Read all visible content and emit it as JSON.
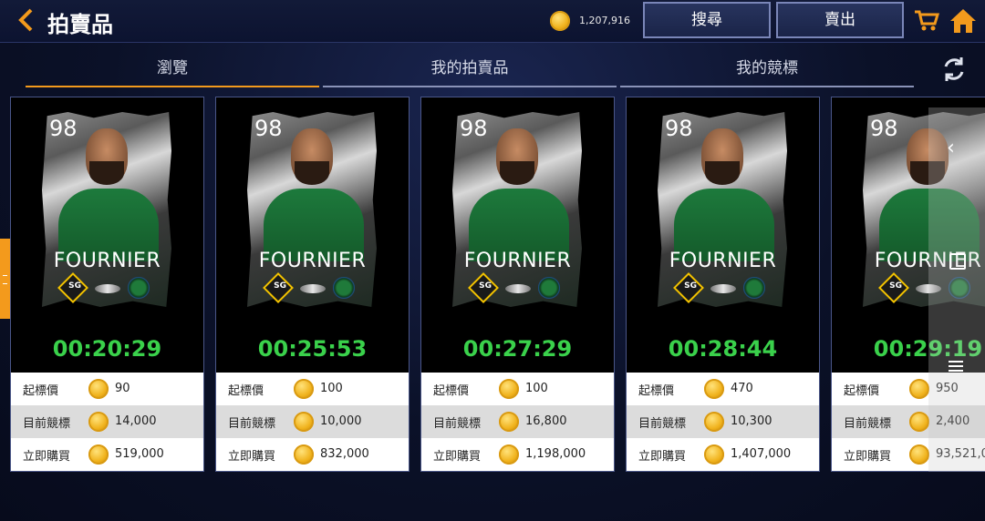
{
  "header": {
    "back_icon": "chevron-left-icon",
    "title": "拍賣品",
    "balance": "1,207,916",
    "search_label": "搜尋",
    "sell_label": "賣出",
    "cart_icon": "cart-icon",
    "home_icon": "home-icon",
    "accent_color": "#f39a1c"
  },
  "tabs": [
    {
      "label": "瀏覽",
      "active": true
    },
    {
      "label": "我的拍賣品",
      "active": false
    },
    {
      "label": "我的競標",
      "active": false
    }
  ],
  "refresh_icon": "refresh-icon",
  "row_labels": {
    "start": "起標價",
    "current": "目前競標",
    "buy": "立即購買"
  },
  "cards": [
    {
      "rating": "98",
      "name": "FOURNIER",
      "position": "SG",
      "timer": "00:20:29",
      "start": "90",
      "current": "14,000",
      "buy": "519,000"
    },
    {
      "rating": "98",
      "name": "FOURNIER",
      "position": "SG",
      "timer": "00:25:53",
      "start": "100",
      "current": "10,000",
      "buy": "832,000"
    },
    {
      "rating": "98",
      "name": "FOURNIER",
      "position": "SG",
      "timer": "00:27:29",
      "start": "100",
      "current": "16,800",
      "buy": "1,198,000"
    },
    {
      "rating": "98",
      "name": "FOURNIER",
      "position": "SG",
      "timer": "00:28:44",
      "start": "470",
      "current": "10,300",
      "buy": "1,407,000"
    },
    {
      "rating": "98",
      "name": "FOURNIER",
      "position": "SG",
      "timer": "00:29:19",
      "start": "950",
      "current": "2,400",
      "buy": "93,521,0"
    }
  ],
  "timer_color": "#3ad14b"
}
